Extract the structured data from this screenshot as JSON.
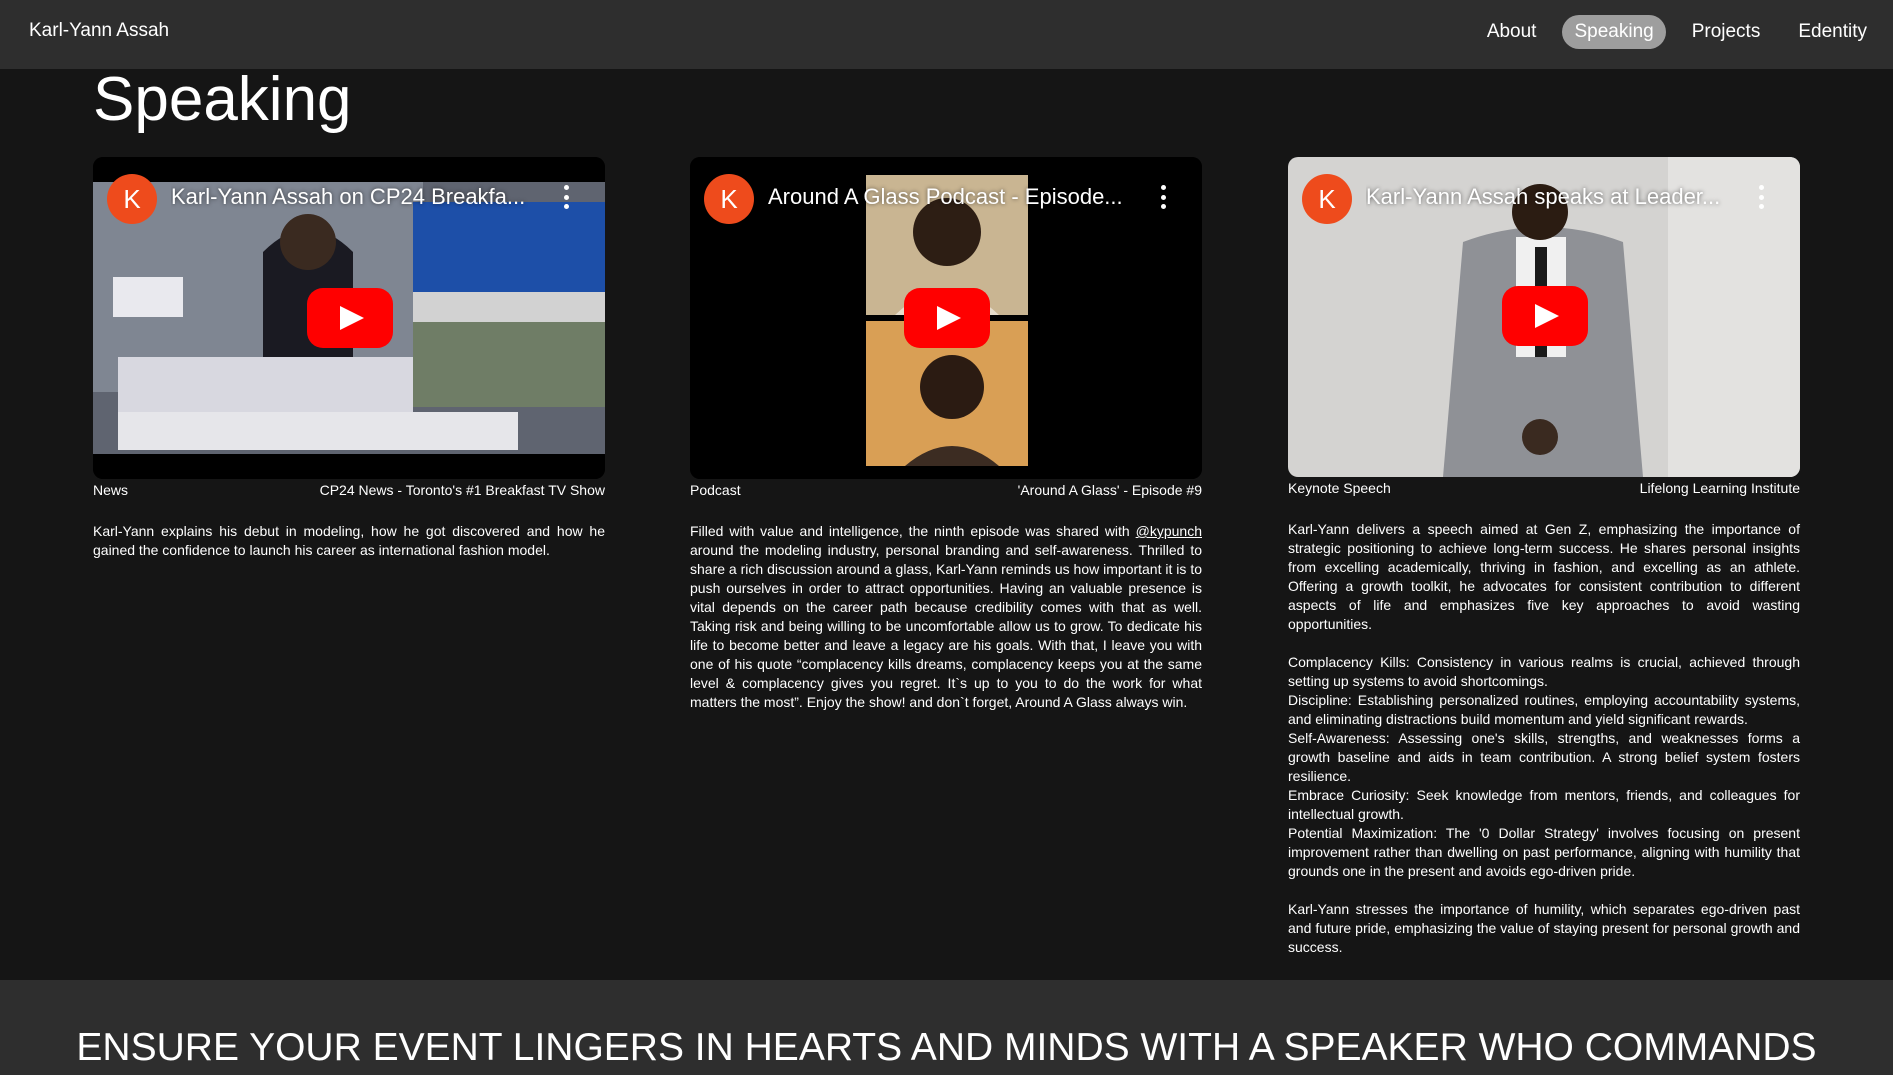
{
  "header": {
    "brand": "Karl-Yann Assah",
    "nav": [
      {
        "label": "About",
        "active": false
      },
      {
        "label": "Speaking",
        "active": true
      },
      {
        "label": "Projects",
        "active": false
      },
      {
        "label": "Edentity",
        "active": false
      }
    ]
  },
  "page": {
    "title": "Speaking"
  },
  "cards": [
    {
      "video": {
        "channel_initial": "K",
        "title": "Karl-Yann Assah on CP24 Breakfa...",
        "channel_color": "#ee4b1c"
      },
      "category": "News",
      "source": "CP24 News - Toronto's #1 Breakfast TV Show",
      "paragraphs": [
        "Karl-Yann explains his debut in modeling, how he got discovered and how he gained the confidence to launch his career as international fashion model."
      ]
    },
    {
      "video": {
        "channel_initial": "K",
        "title": "Around A Glass Podcast - Episode...",
        "channel_color": "#ee4b1c"
      },
      "category": "Podcast",
      "source": "'Around A Glass' - Episode #9",
      "desc_before_link": "Filled with value and intelligence, the ninth episode was shared with ",
      "desc_link": "@kypunch",
      "desc_after_link": " around the modeling industry, personal branding and self-awareness. Thrilled to share a rich discussion around a glass, Karl-Yann reminds us how important it is to push ourselves in order to attract opportunities. Having an valuable presence is vital depends on the career path because credibility comes with that as well. Taking risk and being willing to be uncomfortable allow us to grow. To dedicate his life to become better and leave a legacy are his goals. With that, I leave you with one of his quote “complacency kills dreams, complacency keeps you at the same level & complacency gives you regret. It`s up to you to do the work for what matters the most”. Enjoy the show! and don`t forget, Around A Glass always win."
    },
    {
      "video": {
        "channel_initial": "K",
        "title": "Karl-Yann Assah speaks at Leader...",
        "channel_color": "#ee4b1c"
      },
      "category": "Keynote Speech",
      "source": "Lifelong Learning Institute",
      "intro": "Karl-Yann delivers a speech aimed at Gen Z, emphasizing the importance of strategic positioning to achieve long-term success. He shares personal insights from excelling academically, thriving in fashion, and excelling as an athlete. Offering a growth toolkit, he advocates for consistent contribution to different aspects of life and emphasizes five key approaches to avoid wasting opportunities.",
      "points": [
        "Complacency Kills: Consistency in various realms is crucial, achieved through setting up systems to avoid shortcomings.",
        "Discipline: Establishing personalized routines, employing accountability systems, and eliminating distractions build momentum and yield significant rewards.",
        "Self-Awareness: Assessing one's skills, strengths, and weaknesses forms a growth baseline and aids in team contribution. A strong belief system fosters resilience.",
        "Embrace Curiosity: Seek knowledge from mentors, friends, and colleagues for intellectual growth.",
        "Potential Maximization: The '0 Dollar Strategy' involves focusing on present improvement rather than dwelling on past performance, aligning with humility that grounds one in the present and avoids ego-driven pride."
      ],
      "closing": "Karl-Yann stresses the importance of humility, which separates ego-driven past and future pride, emphasizing the value of staying present for personal growth and success."
    }
  ],
  "footer": {
    "cta": "ENSURE YOUR EVENT LINGERS IN HEARTS AND MINDS WITH A SPEAKER WHO COMMANDS"
  },
  "colors": {
    "topbar": "#2e2e2e",
    "background": "#151515",
    "nav_active": "#9e9e9e",
    "play_button": "#ff0000"
  }
}
